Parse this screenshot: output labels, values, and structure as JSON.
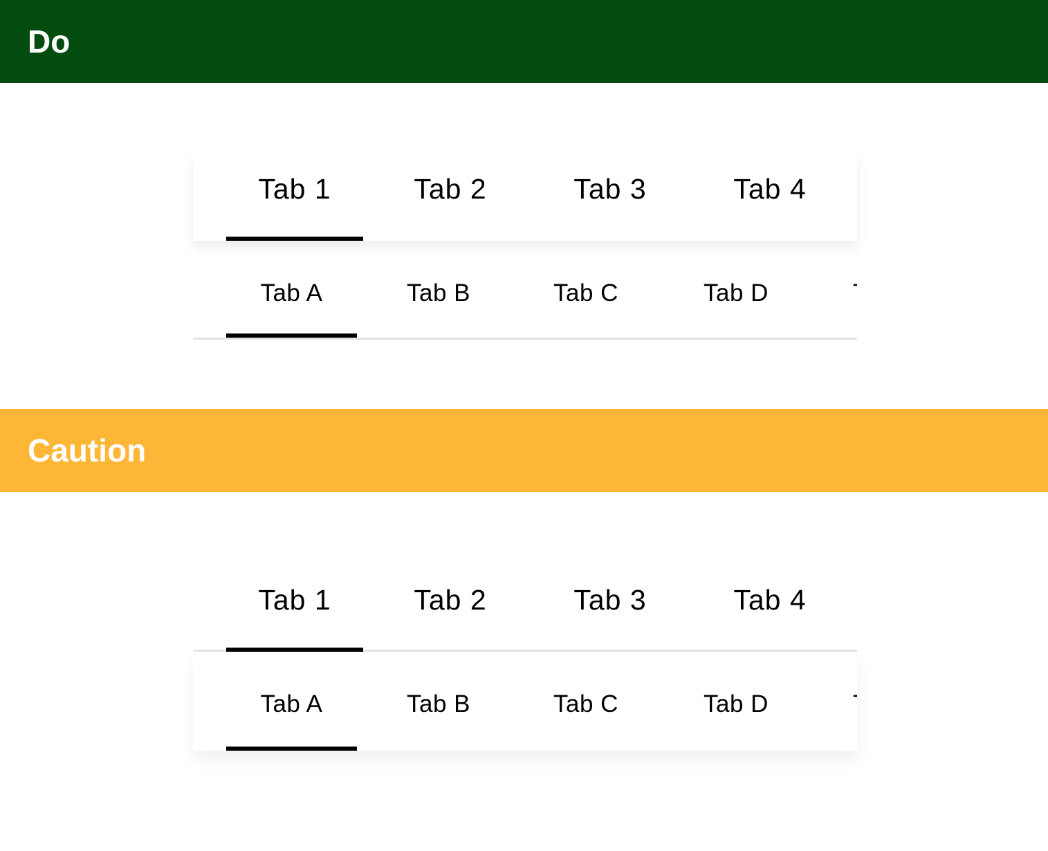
{
  "colors": {
    "do_banner": "#024c10",
    "caution_banner": "#fdb636",
    "active_indicator": "#000000",
    "divider": "#e3e3e3"
  },
  "do_section": {
    "title": "Do",
    "primary_tabs": [
      "Tab 1",
      "Tab 2",
      "Tab 3",
      "Tab 4"
    ],
    "secondary_tabs": [
      "Tab A",
      "Tab B",
      "Tab C",
      "Tab D",
      "T"
    ],
    "primary_selected": "Tab 1",
    "secondary_selected": "Tab A"
  },
  "caution_section": {
    "title": "Caution",
    "primary_tabs": [
      "Tab 1",
      "Tab 2",
      "Tab 3",
      "Tab 4"
    ],
    "secondary_tabs": [
      "Tab A",
      "Tab B",
      "Tab C",
      "Tab D",
      "T"
    ],
    "primary_selected": "Tab 1",
    "secondary_selected": "Tab A"
  }
}
